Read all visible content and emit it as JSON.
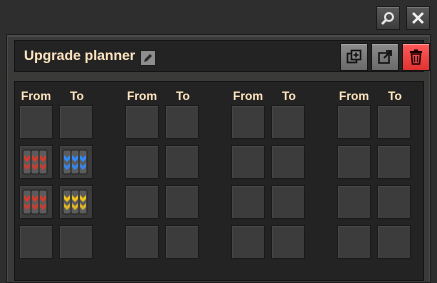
{
  "window": {
    "search_icon": "search-icon",
    "close_icon": "close-icon"
  },
  "planner": {
    "title": "Upgrade planner",
    "edit_icon": "pencil-icon",
    "buttons": [
      "copy-icon",
      "export-icon",
      "trash-icon"
    ]
  },
  "columns": [
    {
      "from": "From",
      "to": "To"
    },
    {
      "from": "From",
      "to": "To"
    },
    {
      "from": "From",
      "to": "To"
    },
    {
      "from": "From",
      "to": "To"
    }
  ],
  "rules": [
    {
      "column": 0,
      "row": 1,
      "from": "transport-belt",
      "to": "fast-transport-belt"
    },
    {
      "column": 0,
      "row": 2,
      "from": "transport-belt",
      "to": "express-transport-belt"
    }
  ],
  "colors": {
    "label": "#ffe6c0",
    "belt_red": "#d63a2a",
    "belt_blue": "#2f8cff",
    "belt_yellow": "#f0c21a",
    "delete_button": "#ff4444"
  }
}
